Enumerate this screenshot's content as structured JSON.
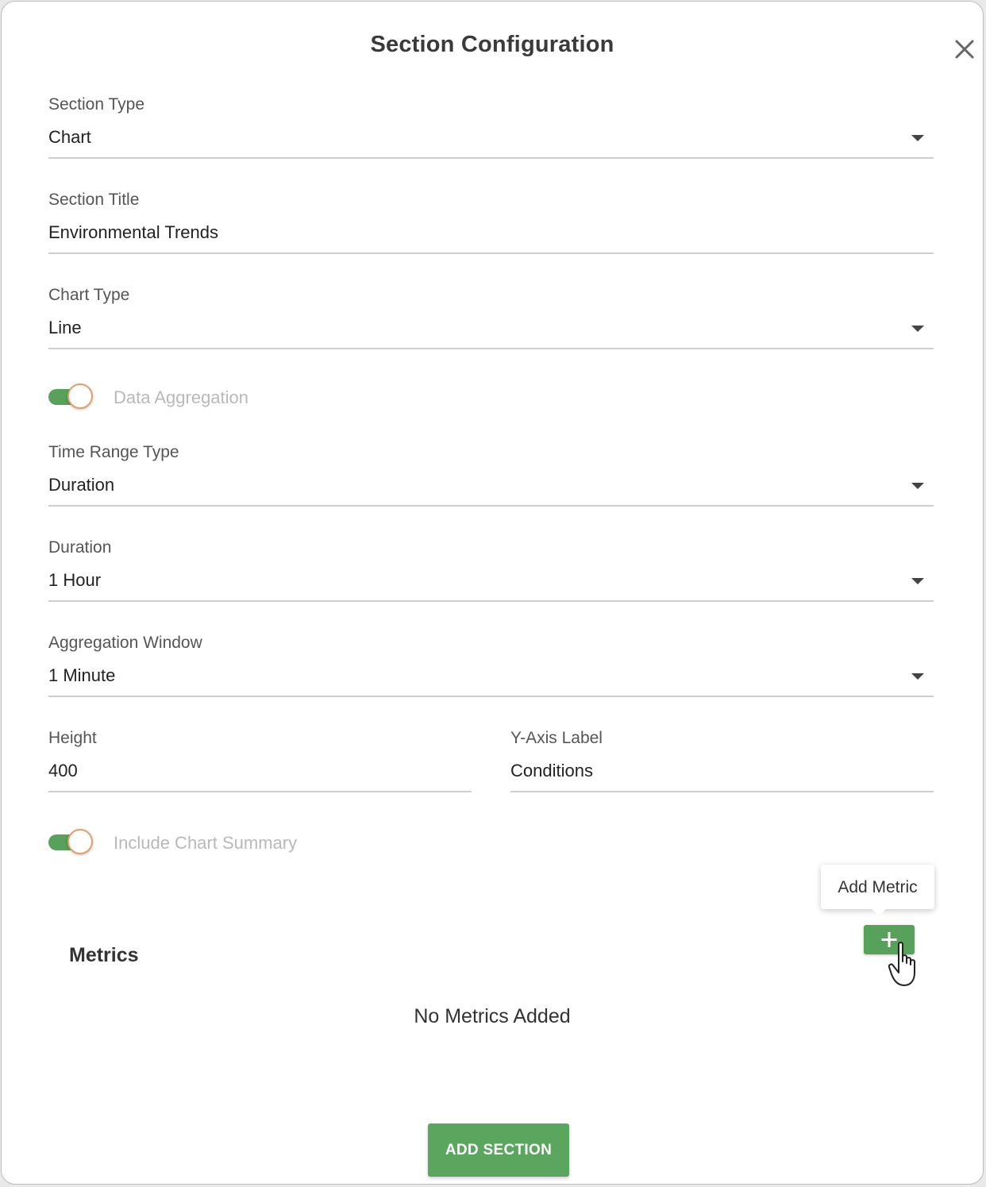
{
  "dialog": {
    "title": "Section Configuration",
    "close_icon": "close-icon"
  },
  "fields": {
    "section_type": {
      "label": "Section Type",
      "value": "Chart"
    },
    "section_title": {
      "label": "Section Title",
      "value": "Environmental Trends"
    },
    "chart_type": {
      "label": "Chart Type",
      "value": "Line"
    },
    "time_range_type": {
      "label": "Time Range Type",
      "value": "Duration"
    },
    "duration": {
      "label": "Duration",
      "value": "1 Hour"
    },
    "aggregation_window": {
      "label": "Aggregation Window",
      "value": "1 Minute"
    },
    "height": {
      "label": "Height",
      "value": "400"
    },
    "y_axis_label": {
      "label": "Y-Axis Label",
      "value": "Conditions"
    }
  },
  "toggles": {
    "data_aggregation": {
      "label": "Data Aggregation",
      "on": true
    },
    "include_chart_summary": {
      "label": "Include Chart Summary",
      "on": true
    }
  },
  "metrics": {
    "heading": "Metrics",
    "add_tooltip": "Add Metric",
    "add_icon": "plus-icon",
    "empty_text": "No Metrics Added"
  },
  "footer": {
    "submit_label": "ADD SECTION"
  },
  "colors": {
    "accent_green": "#57a15a",
    "toggle_thumb_border": "#e3a06a"
  }
}
